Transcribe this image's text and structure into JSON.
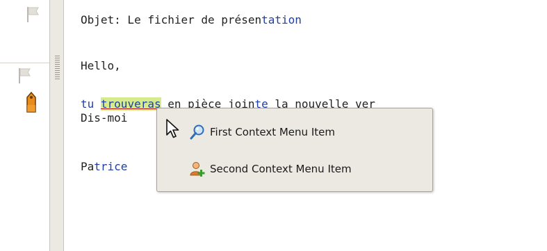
{
  "message": {
    "subject_prefix": "Objet: Le fichier de présen",
    "subject_suffix": "tation",
    "greeting": "Hello,",
    "line3_tu": "tu ",
    "line3_word": "trouveras",
    "line3_rest_a": " en pièce join",
    "line3_rest_b": "te",
    "line3_rest_c": " la nouvelle ver",
    "line4": "Dis-moi",
    "signature_prefix": "Pa",
    "signature_mid": "trice"
  },
  "context_menu": {
    "items": [
      {
        "label": "First Context Menu Item",
        "icon": "search-icon"
      },
      {
        "label": "Second Context Menu Item",
        "icon": "add-user-icon"
      }
    ]
  },
  "colors": {
    "accent_blue": "#1f3fa3",
    "misspelling_highlight": "#d6eb8c",
    "menu_background": "#ece9e3"
  }
}
